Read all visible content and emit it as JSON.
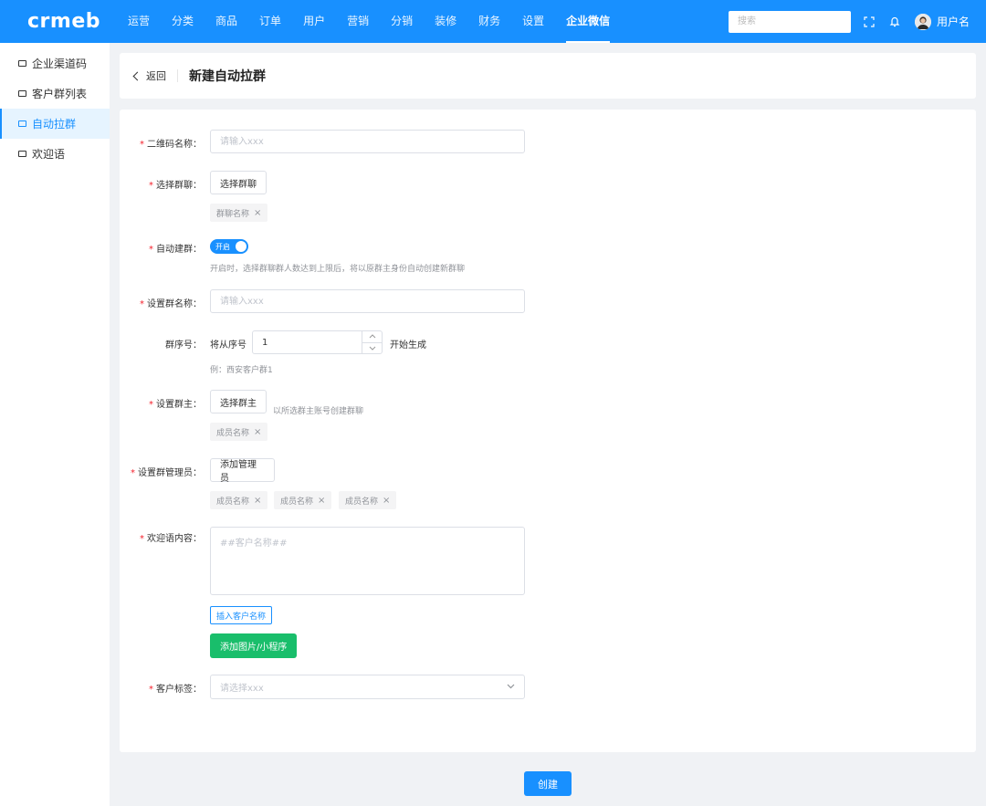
{
  "header": {
    "logo": "crmeb",
    "nav": [
      "运营",
      "分类",
      "商品",
      "订单",
      "用户",
      "营销",
      "分销",
      "装修",
      "财务",
      "设置",
      "企业微信"
    ],
    "active_nav": "企业微信",
    "search_placeholder": "搜索",
    "username": "用户名"
  },
  "sidebar": {
    "items": [
      "企业渠道码",
      "客户群列表",
      "自动拉群",
      "欢迎语"
    ],
    "active": "自动拉群"
  },
  "title_bar": {
    "back_label": "返回",
    "title": "新建自动拉群"
  },
  "form": {
    "qrcode_name": {
      "label": "二维码名称：",
      "placeholder": "请输入xxx"
    },
    "select_group": {
      "label": "选择群聊：",
      "button": "选择群聊",
      "tag": "群聊名称"
    },
    "auto_create": {
      "label": "自动建群：",
      "switch_text": "开启",
      "hint": "开启时，选择群聊群人数达到上限后，将以原群主身份自动创建新群聊"
    },
    "group_name": {
      "label": "设置群名称：",
      "placeholder": "请输入xxx"
    },
    "group_seq": {
      "label": "群序号：",
      "prefix": "将从序号",
      "value": "1",
      "suffix": "开始生成",
      "example": "例：西安客户群1"
    },
    "owner": {
      "label": "设置群主：",
      "button": "选择群主",
      "hint": "以所选群主账号创建群聊",
      "tag": "成员名称"
    },
    "admins": {
      "label": "设置群管理员：",
      "button": "添加管理员",
      "tags": [
        "成员名称",
        "成员名称",
        "成员名称"
      ]
    },
    "welcome": {
      "label": "欢迎语内容：",
      "placeholder": "##客户名称##",
      "insert_button": "插入客户名称",
      "add_media_button": "添加图片/小程序"
    },
    "customer_tag": {
      "label": "客户标签：",
      "placeholder": "请选择xxx"
    }
  },
  "submit_label": "创建",
  "colors": {
    "primary": "#1890ff",
    "success": "#19be6b",
    "required": "#f5222d"
  }
}
